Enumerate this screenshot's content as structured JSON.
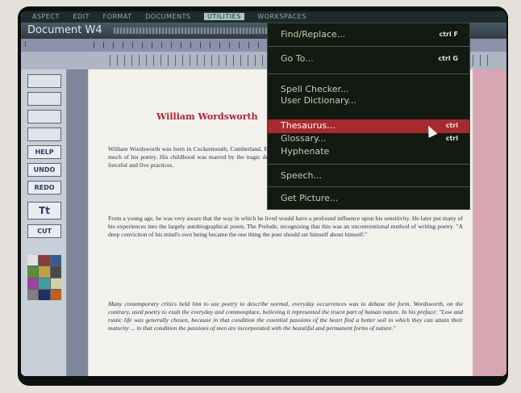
{
  "menubar": {
    "items": [
      "ASPECT",
      "EDIT",
      "FORMAT",
      "DOCUMENTS",
      "UTILITIES",
      "WORKSPACES"
    ],
    "active_index": 4
  },
  "window": {
    "title": "Document W4"
  },
  "toolbar": {
    "buttons": [
      "HELP",
      "UNDO",
      "REDO",
      "Tt",
      "CUT"
    ]
  },
  "document": {
    "title": "William Wordsworth",
    "paragraphs": [
      "William Wordsworth was born in Cockermouth, Cumberland, England. He grew up in the Lake District, which was to provide inspiration for much of his poetry. His childhood was marred by the tragic deaths of his parents. His life. Whether he was just right poured as well as his forceful and five practices.",
      "From a young age, he was very aware that the way in which he lived would have a profound influence upon his sensitivity. He later put many of his experiences into the largely autobiographical poem, The Prelude, recognizing that this was an unconventional method of writing poetry. \"A deep conviction of his mind's own being became the one thing the poet should set himself about himself.\"",
      "Many contemporary critics held him to use poetry to describe normal, everyday occurrences was to debase the form. Wordsworth, on the contrary, used poetry to exalt the everyday and commonplace, believing it represented the truest part of human nature. In his preface: \"Low and rustic life was generally chosen, because in that condition the essential passions of the heart find a better soil in which they can attain their maturity ... in that condition the passions of men are incorporated with the beautiful and permanent forms of nature.\""
    ]
  },
  "dropdown": {
    "items": [
      {
        "label": "Find/Replace...",
        "shortcut": "ctrl F"
      },
      {
        "label": "Go To...",
        "shortcut": "ctrl G"
      },
      {
        "label": "Spell Checker...",
        "shortcut": ""
      },
      {
        "label": "User Dictionary...",
        "shortcut": ""
      },
      {
        "label": "Thesaurus...",
        "shortcut": "ctrl"
      },
      {
        "label": "Glossary...",
        "shortcut": "ctrl"
      },
      {
        "label": "Hyphenate",
        "shortcut": ""
      },
      {
        "label": "Speech...",
        "shortcut": ""
      },
      {
        "label": "Get Picture...",
        "shortcut": ""
      }
    ],
    "selected_index": 4
  },
  "colors": {
    "menu_bg": "#121a12",
    "highlight": "#a72a2f",
    "title_red": "#b2223a",
    "palette": [
      "#e0e0e0",
      "#8c3a3a",
      "#3a5a8c",
      "#5a8c3a",
      "#c0a040",
      "#4a4a4a",
      "#a040a0",
      "#40a0a0",
      "#d0d0a0",
      "#808080",
      "#203060",
      "#c06020"
    ]
  }
}
